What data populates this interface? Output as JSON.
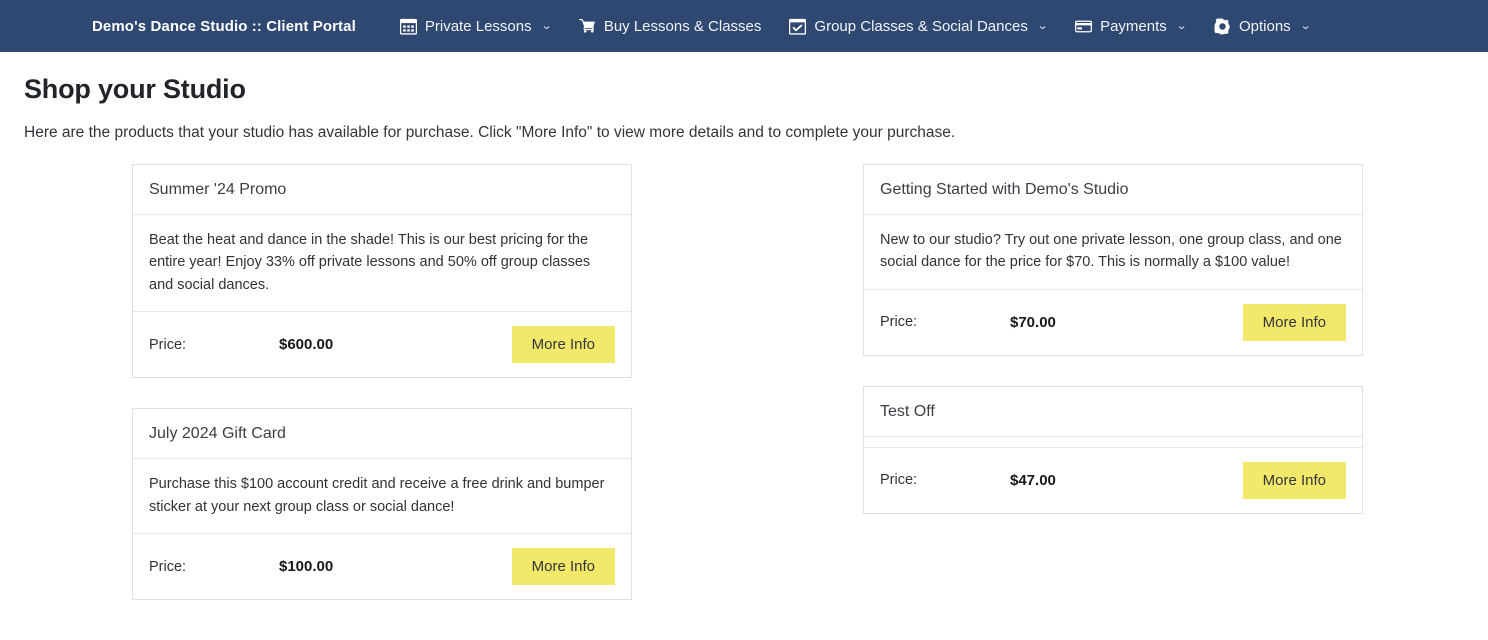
{
  "nav": {
    "brand": "Demo's Dance Studio :: Client Portal",
    "items": [
      {
        "label": "Private Lessons",
        "icon": "calendar-grid-icon",
        "caret": "⌄",
        "has_caret": true
      },
      {
        "label": "Buy Lessons & Classes",
        "icon": "shopping-cart-icon",
        "caret": "",
        "has_caret": false
      },
      {
        "label": "Group Classes & Social Dances",
        "icon": "calendar-check-icon",
        "caret": "⌄",
        "has_caret": true
      },
      {
        "label": "Payments",
        "icon": "credit-card-icon",
        "caret": "⌄",
        "has_caret": true
      },
      {
        "label": "Options",
        "icon": "gear-icon",
        "caret": "⌄",
        "has_caret": true
      }
    ],
    "background_color": "#2f4872"
  },
  "page": {
    "title": "Shop your Studio",
    "description": "Here are the products that your studio has available for purchase. Click \"More Info\" to view more details and to complete your purchase."
  },
  "labels": {
    "price": "Price:",
    "more_info": "More Info"
  },
  "theme": {
    "accent_button": "#f2e96b",
    "card_border": "#e0e0e0"
  },
  "products": {
    "left": [
      {
        "title": "Summer '24 Promo",
        "description": "Beat the heat and dance in the shade! This is our best pricing for the entire year! Enjoy 33% off private lessons and 50% off group classes and social dances.",
        "price_label": "Price:",
        "price": "$600.00",
        "button": "More Info",
        "has_description": true
      },
      {
        "title": "July 2024 Gift Card",
        "description": "Purchase this $100 account credit and receive a free drink and bumper sticker at your next group class or social dance!",
        "price_label": "Price:",
        "price": "$100.00",
        "button": "More Info",
        "has_description": true
      }
    ],
    "right": [
      {
        "title": "Getting Started with Demo's Studio",
        "description": "New to our studio? Try out one private lesson, one group class, and one social dance for the price for $70. This is normally a $100 value!",
        "price_label": "Price:",
        "price": "$70.00",
        "button": "More Info",
        "has_description": true
      },
      {
        "title": "Test Off",
        "description": "",
        "price_label": "Price:",
        "price": "$47.00",
        "button": "More Info",
        "has_description": false
      }
    ]
  }
}
